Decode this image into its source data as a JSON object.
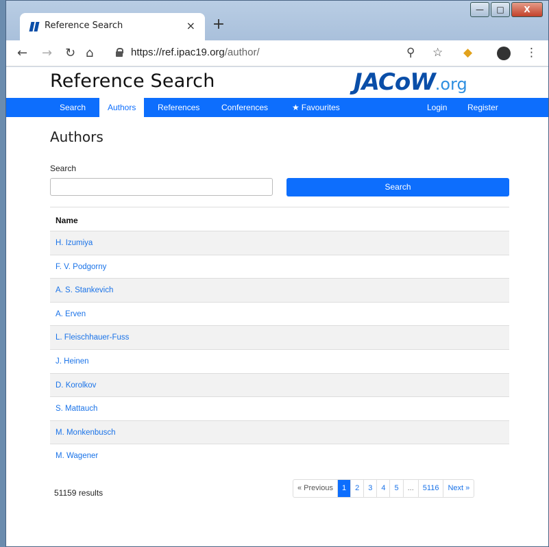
{
  "browser": {
    "tab_title": "Reference Search",
    "tab_close": "×",
    "new_tab": "+",
    "url_host": "https://ref.ipac19.org",
    "url_path": "/author/",
    "window_buttons": [
      "—",
      "□",
      "X"
    ]
  },
  "header": {
    "site_title": "Reference Search",
    "brand_main": "JACoW",
    "brand_suffix": ".org"
  },
  "nav": {
    "items": [
      "Search",
      "Authors",
      "References",
      "Conferences",
      "Favourites"
    ],
    "right_items": [
      "Login",
      "Register"
    ],
    "active": "Authors"
  },
  "main": {
    "heading": "Authors",
    "search_label": "Search",
    "search_value": "",
    "search_button": "Search"
  },
  "table": {
    "header": "Name",
    "rows": [
      "H. Izumiya",
      "F. V. Podgorny",
      "A. S. Stankevich",
      "A. Erven",
      "L. Fleischhauer-Fuss",
      "J. Heinen",
      "D. Korolkov",
      "S. Mattauch",
      "M. Monkenbusch",
      "M. Wagener"
    ]
  },
  "footer": {
    "results": "51159 results",
    "pager": [
      "« Previous",
      "1",
      "2",
      "3",
      "4",
      "5",
      "...",
      "5116",
      "Next »"
    ],
    "current_page": "1"
  },
  "colors": {
    "primary": "#0d6efd",
    "link": "#1a73e8",
    "brand": "#0a4ea8"
  }
}
